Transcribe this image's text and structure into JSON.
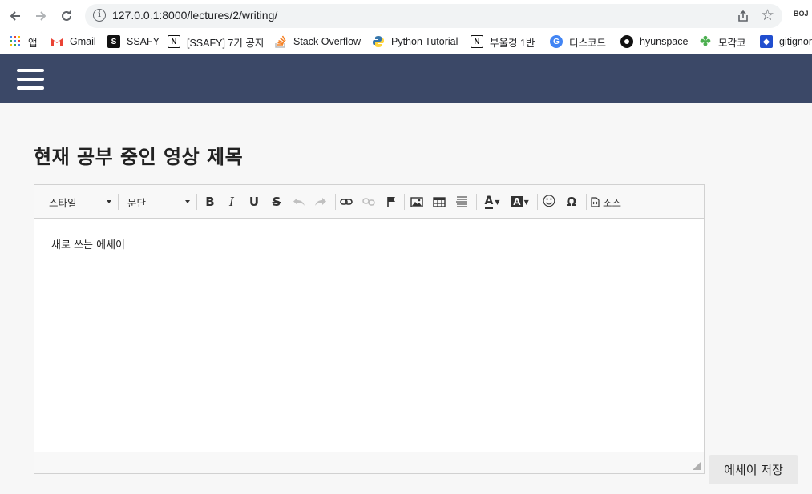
{
  "browser": {
    "url": "127.0.0.1:8000/lectures/2/writing/",
    "extension_label": "BOJ",
    "bookmarks": [
      {
        "label": "앱",
        "icon": "apps-grid-icon"
      },
      {
        "label": "Gmail",
        "icon": "gmail-icon"
      },
      {
        "label": "SSAFY",
        "icon": "ssafy-icon"
      },
      {
        "label": "[SSAFY] 7기 공지",
        "icon": "notion-icon"
      },
      {
        "label": "Stack Overflow",
        "icon": "stackoverflow-icon"
      },
      {
        "label": "Python Tutorial",
        "icon": "python-icon"
      },
      {
        "label": "부울경 1반",
        "icon": "notion-icon"
      },
      {
        "label": "디스코드",
        "icon": "discord-icon"
      },
      {
        "label": "hyunspace",
        "icon": "github-icon"
      },
      {
        "label": "모각코",
        "icon": "clover-icon"
      },
      {
        "label": "gitignore",
        "icon": "gitignore-icon"
      }
    ]
  },
  "header": {
    "menu_icon": "hamburger-menu-icon",
    "color": "#3b4867"
  },
  "page": {
    "title": "현재 공부 중인 영상 제목"
  },
  "editor": {
    "style_combo": "스타일",
    "format_combo": "문단",
    "source_label": "소스",
    "content": "새로 쓰는 에세이"
  },
  "actions": {
    "save_label": "에세이 저장"
  }
}
